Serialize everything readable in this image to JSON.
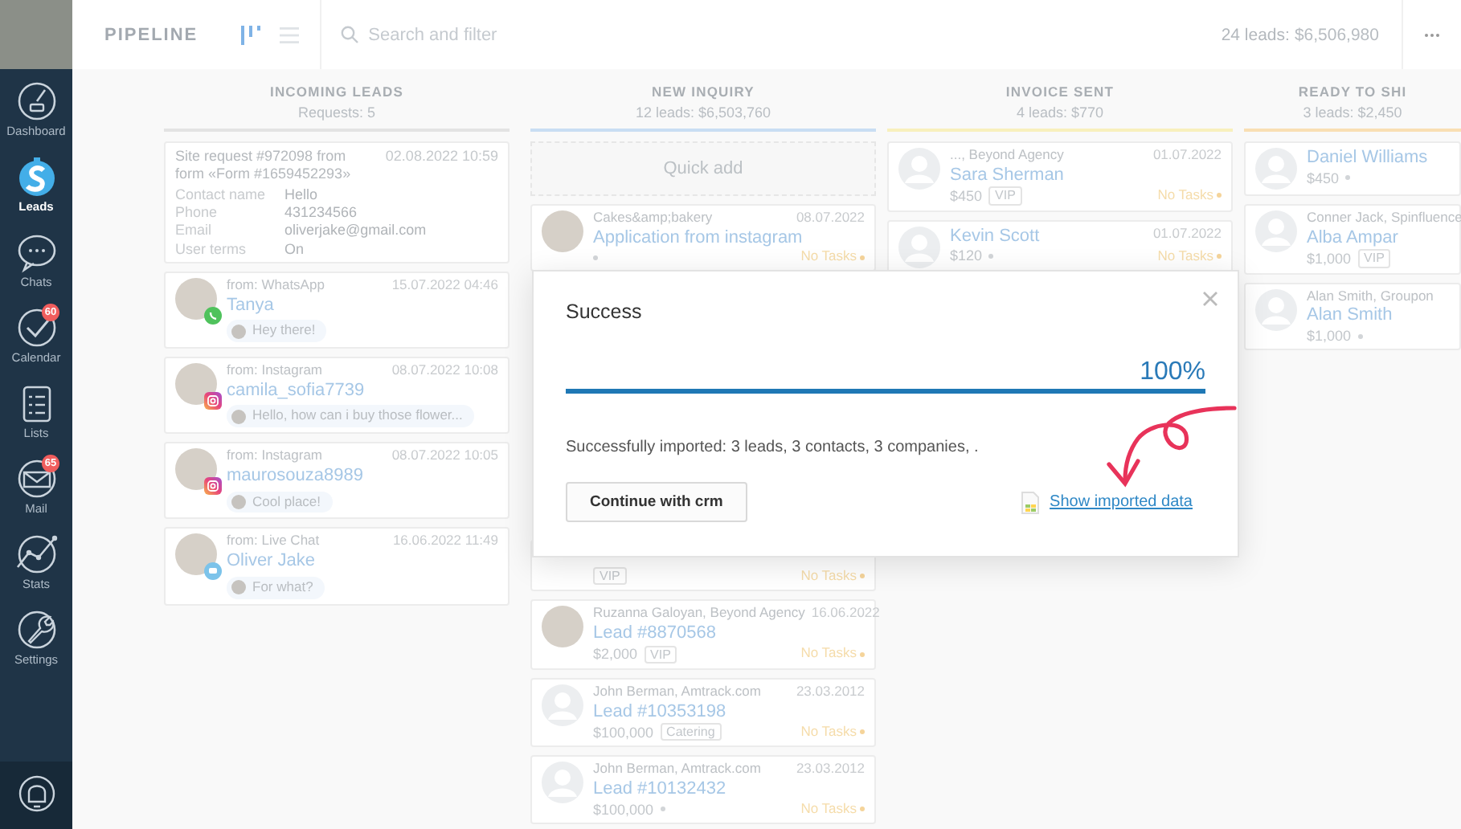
{
  "sidebar": {
    "items": [
      {
        "label": "Dashboard",
        "kind": "dashboard",
        "selected": false
      },
      {
        "label": "Leads",
        "kind": "leads",
        "selected": true
      },
      {
        "label": "Chats",
        "kind": "chats",
        "selected": false
      },
      {
        "label": "Calendar",
        "kind": "calendar",
        "selected": false,
        "badge": "60"
      },
      {
        "label": "Lists",
        "kind": "lists",
        "selected": false
      },
      {
        "label": "Mail",
        "kind": "mail",
        "selected": false,
        "badge": "65"
      },
      {
        "label": "Stats",
        "kind": "stats",
        "selected": false
      },
      {
        "label": "Settings",
        "kind": "settings",
        "selected": false
      }
    ]
  },
  "header": {
    "title": "PIPELINE",
    "views": [
      {
        "kind": "board",
        "selected": true
      },
      {
        "kind": "list",
        "selected": false
      }
    ],
    "search": {
      "placeholder": "Search and filter"
    },
    "summary_label": "24 leads:",
    "summary_value": "$6,506,980"
  },
  "columns": [
    {
      "title": "INCOMING LEADS",
      "subtitle": "Requests: 5",
      "color": "#e3e3e3",
      "cards": [
        {
          "kind": "form",
          "title": "Site request #972098 from form «Form #1659452293»",
          "date": "02.08.2022 10:59",
          "fields": [
            {
              "label": "Contact name",
              "value": "Hello"
            },
            {
              "label": "Phone",
              "value": "431234566"
            },
            {
              "label": "Email",
              "value": "oliverjake@gmail.com"
            },
            {
              "label": "User terms",
              "value": "On"
            }
          ]
        },
        {
          "kind": "chat",
          "channel": {
            "kind": "whatsapp"
          },
          "source": "from: WhatsApp",
          "date": "15.07.2022 04:46",
          "name": "Tanya",
          "message": "Hey there!"
        },
        {
          "kind": "chat",
          "channel": {
            "kind": "instagram"
          },
          "source": "from: Instagram",
          "date": "08.07.2022 10:08",
          "name": "camila_sofia7739",
          "message": "Hello, how can i buy those flower..."
        },
        {
          "kind": "chat",
          "channel": {
            "kind": "instagram"
          },
          "source": "from: Instagram",
          "date": "08.07.2022 10:05",
          "name": "maurosouza8989",
          "message": "Cool place!"
        },
        {
          "kind": "chat",
          "channel": {
            "kind": "livechat"
          },
          "source": "from: Live Chat",
          "date": "16.06.2022 11:49",
          "name": "Oliver Jake",
          "message": "For what?"
        }
      ]
    },
    {
      "title": "NEW INQUIRY",
      "subtitle": "12 leads: $6,503,760",
      "color": "#c9def3",
      "quick_add": "Quick add",
      "cards": [
        {
          "kind": "lead",
          "avatar": {
            "kind": "photo"
          },
          "byline": "Cakes&amp;bakery",
          "date": "08.07.2022",
          "name": "Application from instagram",
          "tasks": "No Tasks"
        },
        {
          "kind": "partial",
          "tag": "VIP",
          "tasks": "No Tasks"
        },
        {
          "kind": "lead",
          "avatar": {
            "kind": "photo"
          },
          "byline": "Ruzanna Galoyan, Beyond Agency",
          "date": "16.06.2022",
          "name": "Lead #8870568",
          "price": "$2,000",
          "tag": "VIP",
          "tasks": "No Tasks"
        },
        {
          "kind": "lead",
          "avatar": {
            "kind": "blank"
          },
          "byline": "John Berman, Amtrack.com",
          "date": "23.03.2012",
          "name": "Lead #10353198",
          "price": "$100,000",
          "tag": "Catering",
          "tasks": "No Tasks"
        },
        {
          "kind": "lead",
          "avatar": {
            "kind": "blank"
          },
          "byline": "John Berman, Amtrack.com",
          "date": "23.03.2012",
          "name": "Lead #10132432",
          "price": "$100,000",
          "tasks": "No Tasks"
        }
      ]
    },
    {
      "title": "INVOICE SENT",
      "subtitle": "4 leads: $770",
      "color": "#f8f0bd",
      "cards": [
        {
          "kind": "lead",
          "avatar": {
            "kind": "blank"
          },
          "byline": "..., Beyond Agency",
          "date": "01.07.2022",
          "name": "Sara Sherman",
          "price": "$450",
          "tag": "VIP",
          "tasks": "No Tasks"
        },
        {
          "kind": "lead",
          "avatar": {
            "kind": "blank"
          },
          "date": "01.07.2022",
          "name": "Kevin Scott",
          "price": "$120",
          "tasks": "No Tasks"
        }
      ]
    },
    {
      "title": "READY TO SHI",
      "subtitle": "3 leads: $2,450",
      "color": "#f9dfb3",
      "cards": [
        {
          "kind": "lead",
          "avatar": {
            "kind": "blank"
          },
          "name": "Daniel Williams",
          "price": "$450"
        },
        {
          "kind": "lead",
          "avatar": {
            "kind": "blank"
          },
          "byline": "Conner Jack, Spinfluence",
          "name": "Alba Ampar",
          "price": "$1,000",
          "tag": "VIP"
        },
        {
          "kind": "lead",
          "avatar": {
            "kind": "blank"
          },
          "byline": "Alan Smith, Groupon",
          "name": "Alan Smith",
          "price": "$1,000"
        }
      ]
    }
  ],
  "modal": {
    "title": "Success",
    "progress": {
      "level": 1,
      "reading": "100%"
    },
    "message": "Successfully imported: 3 leads, 3 contacts, 3 companies, .",
    "button": "Continue with crm",
    "link": "Show imported data"
  }
}
